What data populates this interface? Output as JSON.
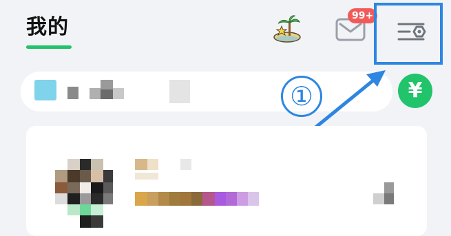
{
  "header": {
    "title": "我的",
    "badge_count": "99+"
  },
  "icons": {
    "island": "island-star-icon",
    "mail": "mail-icon",
    "settings": "settings-list-gear-icon",
    "coin": "yuan-coin-icon"
  },
  "coin_symbol": "¥",
  "annotation": {
    "step_label": "①"
  },
  "colors": {
    "accent_green": "#21c36b",
    "badge_red": "#f25a5a",
    "annotation_blue": "#2d86e0",
    "background": "#f1f3f7"
  }
}
